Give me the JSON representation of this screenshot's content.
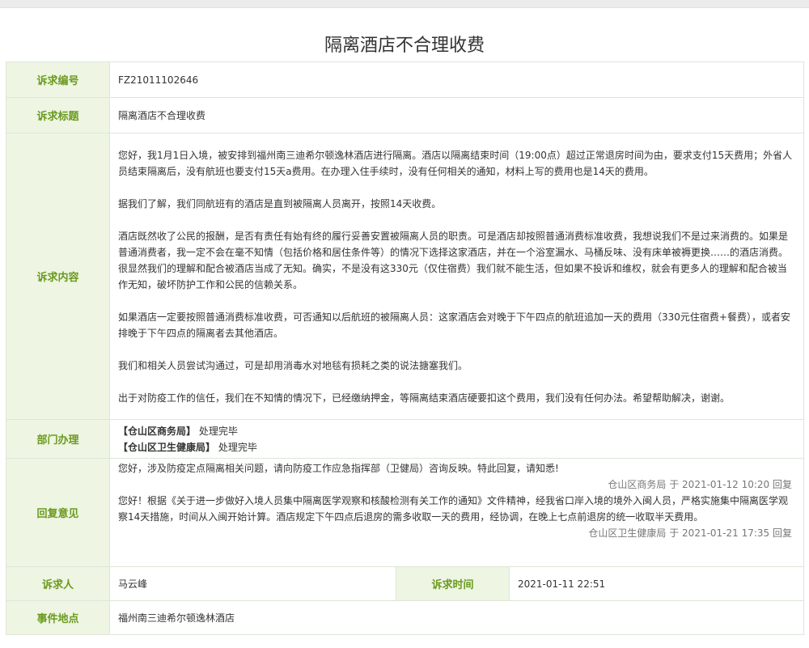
{
  "page_title": "隔离酒店不合理收费",
  "labels": {
    "complaint_no": "诉求编号",
    "complaint_title": "诉求标题",
    "complaint_content": "诉求内容",
    "department": "部门办理",
    "reply": "回复意见",
    "complainant": "诉求人",
    "complaint_time": "诉求时间",
    "location": "事件地点"
  },
  "values": {
    "complaint_no": "FZ21011102646",
    "complaint_title": "隔离酒店不合理收费",
    "complainant": "马云峰",
    "complaint_time": "2021-01-11 22:51",
    "location": "福州南三迪希尔顿逸林酒店"
  },
  "content_paragraphs": [
    "您好，我1月1日入境，被安排到福州南三迪希尔顿逸林酒店进行隔离。酒店以隔离结束时间（19:00点）超过正常退房时间为由，要求支付15天费用；外省人员结束隔离后，没有航班也要支付15天a费用。在办理入住手续时，没有任何相关的通知，材料上写的费用也是14天的费用。",
    "据我们了解，我们同航班有的酒店是直到被隔离人员离开，按照14天收费。",
    "酒店既然收了公民的报酬，是否有责任有始有终的履行妥善安置被隔离人员的职责。可是酒店却按照普通消费标准收费，我想说我们不是过来消费的。如果是普通消费者，我一定不会在毫不知情（包括价格和居住条件等）的情况下选择这家酒店，并在一个浴室漏水、马桶反味、没有床单被褥更换……的酒店消费。很显然我们的理解和配合被酒店当成了无知。确实，不是没有这330元（仅住宿费）我们就不能生活，但如果不投诉和维权，就会有更多人的理解和配合被当作无知，破坏防护工作和公民的信赖关系。",
    "如果酒店一定要按照普通消费标准收费，可否通知以后航班的被隔离人员：这家酒店会对晚于下午四点的航班追加一天的费用（330元住宿费+餐费），或者安排晚于下午四点的隔离者去其他酒店。",
    "我们和相关人员尝试沟通过，可是却用消毒水对地毯有损耗之类的说法搪塞我们。",
    "出于对防疫工作的信任，我们在不知情的情况下，已经缴纳押金，等隔离结束酒店硬要扣这个费用，我们没有任何办法。希望帮助解决，谢谢。"
  ],
  "departments": [
    {
      "name": "【仓山区商务局】",
      "status": " 处理完毕"
    },
    {
      "name": "【仓山区卫生健康局】",
      "status": " 处理完毕"
    }
  ],
  "replies": [
    {
      "text": "您好，涉及防疫定点隔离相关问题，请向防疫工作应急指挥部（卫健局）咨询反映。特此回复，请知悉!",
      "signature": "仓山区商务局 于 2021-01-12 10:20 回复"
    },
    {
      "text": "您好！根据《关于进一步做好入境人员集中隔离医学观察和核酸检测有关工作的通知》文件精神，经我省口岸入境的境外入闽人员，严格实施集中隔离医学观察14天措施，时间从入闽开始计算。酒店规定下午四点后退房的需多收取一天的费用，经协调，在晚上七点前退房的统一收取半天费用。",
      "signature": "仓山区卫生健康局 于 2021-01-21 17:35 回复"
    }
  ]
}
